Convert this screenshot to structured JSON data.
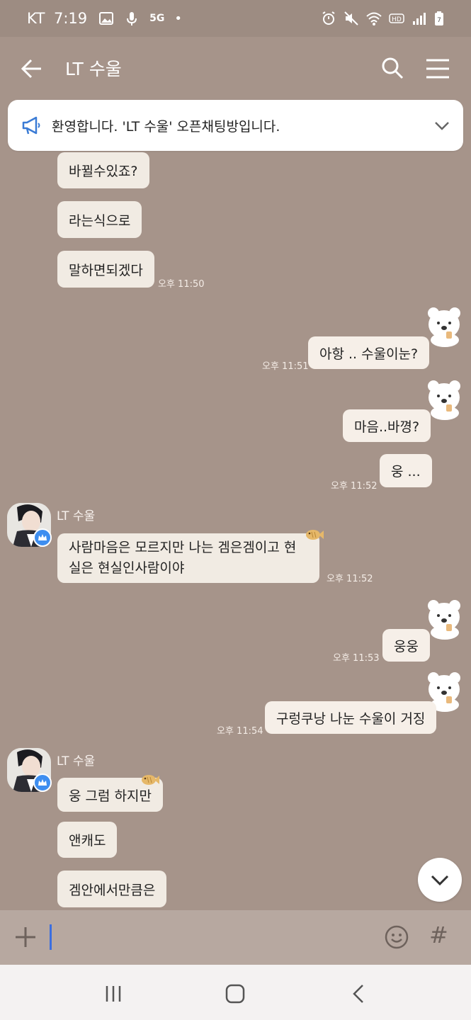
{
  "status_bar": {
    "carrier": "KT",
    "time": "7:19",
    "network": "5G",
    "battery": "7"
  },
  "header": {
    "title": "LT 수울"
  },
  "notice": {
    "text": "환영합니다. 'LT 수울' 오픈채팅방입니다."
  },
  "messages": {
    "m1": "바뀔수있죠?",
    "m2": "라는식으로",
    "m3": "말하면되겠다",
    "m3_time": "오후 11:50",
    "m4": "아항 .. 수울이눈?",
    "m4_time": "오후 11:51",
    "m5": "마음..바꼉?",
    "m6": "웅 ...",
    "m6_time": "오후 11:52",
    "sender1": "LT 수울",
    "m7": "사람마음은 모르지만 나는 겜은겜이고 현실은 현실인사람이야",
    "m7_time": "오후 11:52",
    "m8": "웅웅",
    "m8_time": "오후 11:53",
    "m9": "구렁쿠낭 나눈 수울이 거징",
    "m9_time": "오후 11:54",
    "sender2": "LT 수울",
    "m10": "웅 그럼 하지만",
    "m11": "앤캐도",
    "m12": "겜안에서만큼은"
  },
  "input": {
    "hash_label": "#"
  },
  "icons": {
    "back": "back-arrow-icon",
    "search": "search-icon",
    "menu": "menu-icon",
    "notice": "megaphone-icon",
    "expand": "chevron-down-icon",
    "plus": "plus-icon",
    "emoji": "emoji-icon",
    "scroll": "chevron-down-icon"
  },
  "colors": {
    "background": "#a6948a",
    "bubble": "#f1ebe3",
    "badge": "#3e8ef0"
  }
}
